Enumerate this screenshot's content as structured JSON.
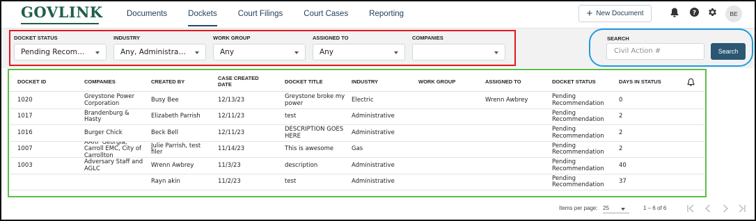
{
  "brand": {
    "logo_text": "GOVLINK"
  },
  "nav": {
    "items": [
      "Documents",
      "Dockets",
      "Court Filings",
      "Court Cases",
      "Reporting"
    ],
    "active": "Dockets"
  },
  "header": {
    "new_document_label": "New Document",
    "avatar_initials": "BE",
    "icons": [
      "bell-icon",
      "help-icon",
      "gear-icon"
    ]
  },
  "filters": {
    "docket_status": {
      "label": "DOCKET STATUS",
      "value": "Pending Recomme..."
    },
    "industry": {
      "label": "INDUSTRY",
      "value": "Any, Administrativ..."
    },
    "work_group": {
      "label": "WORK GROUP",
      "value": "Any"
    },
    "assigned_to": {
      "label": "ASSIGNED TO",
      "value": "Any"
    },
    "companies": {
      "label": "COMPANIES",
      "value": ""
    }
  },
  "search": {
    "label": "SEARCH",
    "placeholder": "Civil Action #",
    "button_label": "Search"
  },
  "table": {
    "columns": [
      "DOCKET ID",
      "COMPANIES",
      "CREATED BY",
      "CASE CREATED DATE",
      "DOCKET TITLE",
      "INDUSTRY",
      "WORK GROUP",
      "ASSIGNED TO",
      "DOCKET STATUS",
      "DAYS IN STATUS"
    ],
    "rows": [
      [
        "1020",
        "Greystone Power Corporation",
        "Busy Bee",
        "12/13/23",
        "Greystone broke my power",
        "Electric",
        "",
        "Wrenn Awbrey",
        "Pending Recommendation",
        "0"
      ],
      [
        "1017",
        "Brandenburg & Hasty",
        "Elizabeth Parrish",
        "12/11/23",
        "test",
        "Administrative",
        "",
        "",
        "Pending Recommendation",
        "2"
      ],
      [
        "1016",
        "Burger Chick",
        "Beck Bell",
        "12/11/23",
        "DESCRIPTION GOES HERE",
        "Administrative",
        "",
        "",
        "Pending Recommendation",
        "2"
      ],
      [
        "1007",
        "AARP Georgia, Carroll EMC, City of Carrollton",
        "Julie Parrish, test filer",
        "11/14/23",
        "This is awesome",
        "Gas",
        "",
        "",
        "Pending Recommendation",
        "2"
      ],
      [
        "1003",
        "Adversary Staff and AGLC",
        "Wrenn Awbrey",
        "11/3/23",
        "description",
        "Administrative",
        "",
        "",
        "Pending Recommendation",
        "40"
      ],
      [
        "",
        "",
        "Rayn akin",
        "11/2/23",
        "test",
        "Administrative",
        "",
        "",
        "Pending Recommendation",
        "37"
      ]
    ]
  },
  "paginator": {
    "items_per_page_label": "Items per page:",
    "items_per_page": "25",
    "range_label": "1 – 6 of 6"
  },
  "colors": {
    "brand_green": "#1f5f4a",
    "nav_text": "#1d3d55",
    "search_button": "#2b5772",
    "annotation_red": "#e2171b",
    "annotation_blue": "#1e9be0",
    "annotation_green": "#5cbd48"
  }
}
